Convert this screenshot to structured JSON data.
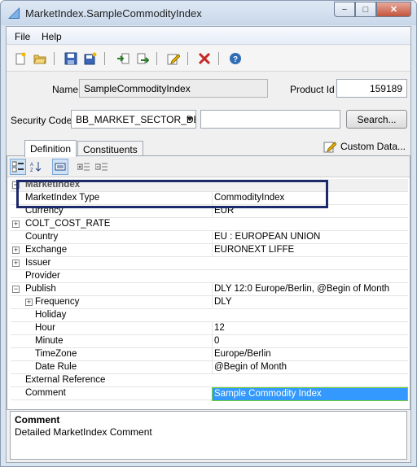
{
  "window": {
    "title": "MarketIndex.SampleCommodityIndex",
    "minimize_glyph": "−",
    "maximize_glyph": "□",
    "close_glyph": "✕"
  },
  "menu": {
    "items": [
      {
        "label": "File"
      },
      {
        "label": "Help"
      }
    ]
  },
  "toolbar": {
    "icons": [
      "new-icon",
      "open-icon",
      "save-icon",
      "save-all-icon",
      "import-icon",
      "export-icon",
      "edit-icon",
      "delete-icon",
      "help-icon"
    ]
  },
  "fields": {
    "name_label": "Name",
    "name_value": "SampleCommodityIndex",
    "product_id_label": "Product Id",
    "product_id_value": "159189",
    "security_code_label": "Security Code",
    "security_code_value": "BB_MARKET_SECTOR_DES",
    "search_value": "",
    "search_button": "Search..."
  },
  "tabs": {
    "definition": "Definition",
    "constituents": "Constituents",
    "custom_data": "Custom Data..."
  },
  "property_grid": {
    "category": "MarketIndex",
    "rows": [
      {
        "name": "MarketIndex Type",
        "value": "CommodityIndex"
      },
      {
        "name": "Currency",
        "value": "EUR"
      },
      {
        "name": "COLT_COST_RATE",
        "value": ""
      },
      {
        "name": "Country",
        "value": "EU : EUROPEAN UNION"
      },
      {
        "name": "Exchange",
        "value": "EURONEXT LIFFE"
      },
      {
        "name": "Issuer",
        "value": ""
      },
      {
        "name": "Provider",
        "value": ""
      },
      {
        "name": "Publish",
        "value": "DLY 12:0 Europe/Berlin, @Begin of Month"
      },
      {
        "name": "Frequency",
        "value": "DLY"
      },
      {
        "name": "Holiday",
        "value": ""
      },
      {
        "name": "Hour",
        "value": "12"
      },
      {
        "name": "Minute",
        "value": "0"
      },
      {
        "name": "TimeZone",
        "value": "Europe/Berlin"
      },
      {
        "name": "Date Rule",
        "value": "@Begin of Month"
      },
      {
        "name": "External Reference",
        "value": ""
      },
      {
        "name": "Comment",
        "value": "Sample Commodity Index"
      }
    ]
  },
  "help": {
    "title": "Comment",
    "description": "Detailed MarketIndex Comment"
  },
  "colors": {
    "accent": "#3399ff",
    "highlight_border": "#1c2a6b"
  }
}
